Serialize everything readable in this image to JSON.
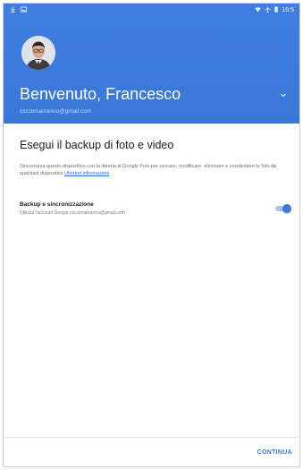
{
  "status_bar": {
    "left_icons": [
      "download-icon",
      "image-icon"
    ],
    "right_icons": [
      "wifi-icon",
      "airplane-icon",
      "battery-icon"
    ],
    "time": "16:5"
  },
  "header": {
    "greeting": "Benvenuto, Francesco",
    "email": "cicciomarrarino@gmail.com",
    "color": "#3a78d8"
  },
  "backup": {
    "title": "Esegui il backup di foto e video",
    "description": "Sincronizza questo dispositivo con la libreria di Google Foto per cercare, modificare, eliminare e condividere le foto da qualsiasi dispositivo",
    "link": "Ulteriori informazioni"
  },
  "setting": {
    "title": "Backup e sincronizzazione",
    "subtitle": "Utilizza l'account Google cicciomarrarino@gmail.com",
    "enabled": true
  },
  "footer": {
    "continue_label": "CONTINUA"
  }
}
